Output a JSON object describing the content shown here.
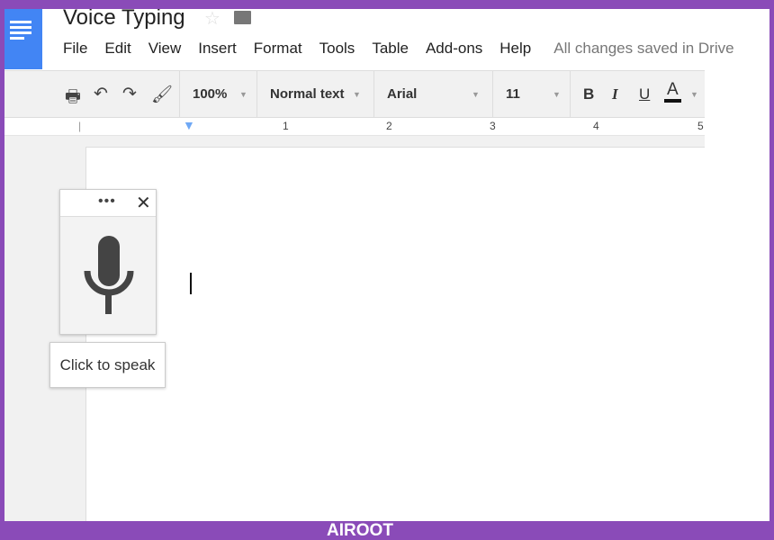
{
  "doc": {
    "title": "Voice Typing",
    "status": "All changes saved in Drive"
  },
  "menu": [
    "File",
    "Edit",
    "View",
    "Insert",
    "Format",
    "Tools",
    "Table",
    "Add-ons",
    "Help"
  ],
  "toolbar": {
    "zoom": "100%",
    "style": "Normal text",
    "font": "Arial",
    "size": "11",
    "bold": "B",
    "italic": "I",
    "underline": "U",
    "text_color": "A"
  },
  "ruler": [
    "1",
    "2",
    "3",
    "4",
    "5"
  ],
  "voice": {
    "more": "•••",
    "close": "✕",
    "tooltip": "Click to speak"
  },
  "footer": {
    "brand": "AIROOT"
  },
  "colors": {
    "brand_frame": "#8a4bb8",
    "docs_blue": "#4285f4"
  }
}
